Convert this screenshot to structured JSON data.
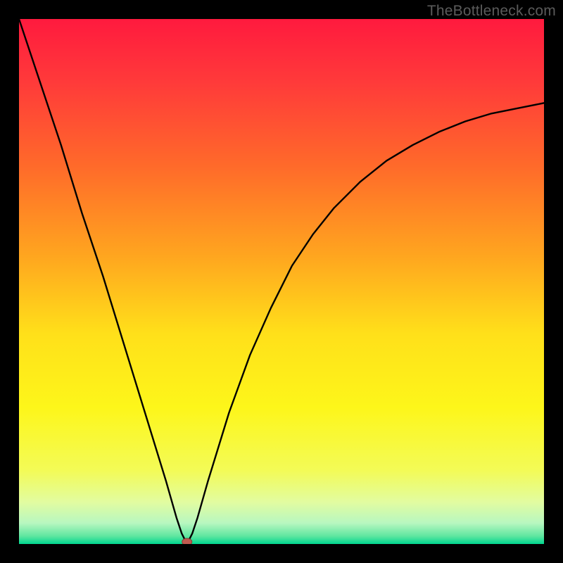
{
  "attribution": "TheBottleneck.com",
  "chart_data": {
    "type": "line",
    "title": "",
    "xlabel": "",
    "ylabel": "",
    "xlim": [
      0,
      100
    ],
    "ylim": [
      0,
      100
    ],
    "minimum_marker": {
      "x": 32,
      "y": 0
    },
    "x": [
      0,
      4,
      8,
      12,
      16,
      20,
      24,
      28,
      30,
      31,
      32,
      33,
      34,
      36,
      40,
      44,
      48,
      52,
      56,
      60,
      65,
      70,
      75,
      80,
      85,
      90,
      95,
      100
    ],
    "y": [
      100,
      88,
      76,
      63,
      51,
      38,
      25,
      12,
      5,
      2,
      0,
      2,
      5,
      12,
      25,
      36,
      45,
      53,
      59,
      64,
      69,
      73,
      76,
      78.5,
      80.5,
      82,
      83,
      84
    ],
    "background_gradient_stops": [
      {
        "offset": 0.0,
        "color": "#ff1a3e"
      },
      {
        "offset": 0.12,
        "color": "#ff3a3a"
      },
      {
        "offset": 0.28,
        "color": "#ff6a2a"
      },
      {
        "offset": 0.45,
        "color": "#ffa51f"
      },
      {
        "offset": 0.6,
        "color": "#ffe01a"
      },
      {
        "offset": 0.74,
        "color": "#fdf61a"
      },
      {
        "offset": 0.86,
        "color": "#f3fb57"
      },
      {
        "offset": 0.92,
        "color": "#e2fca0"
      },
      {
        "offset": 0.96,
        "color": "#b8f7c0"
      },
      {
        "offset": 0.985,
        "color": "#5fe6a0"
      },
      {
        "offset": 1.0,
        "color": "#00d68f"
      }
    ]
  }
}
